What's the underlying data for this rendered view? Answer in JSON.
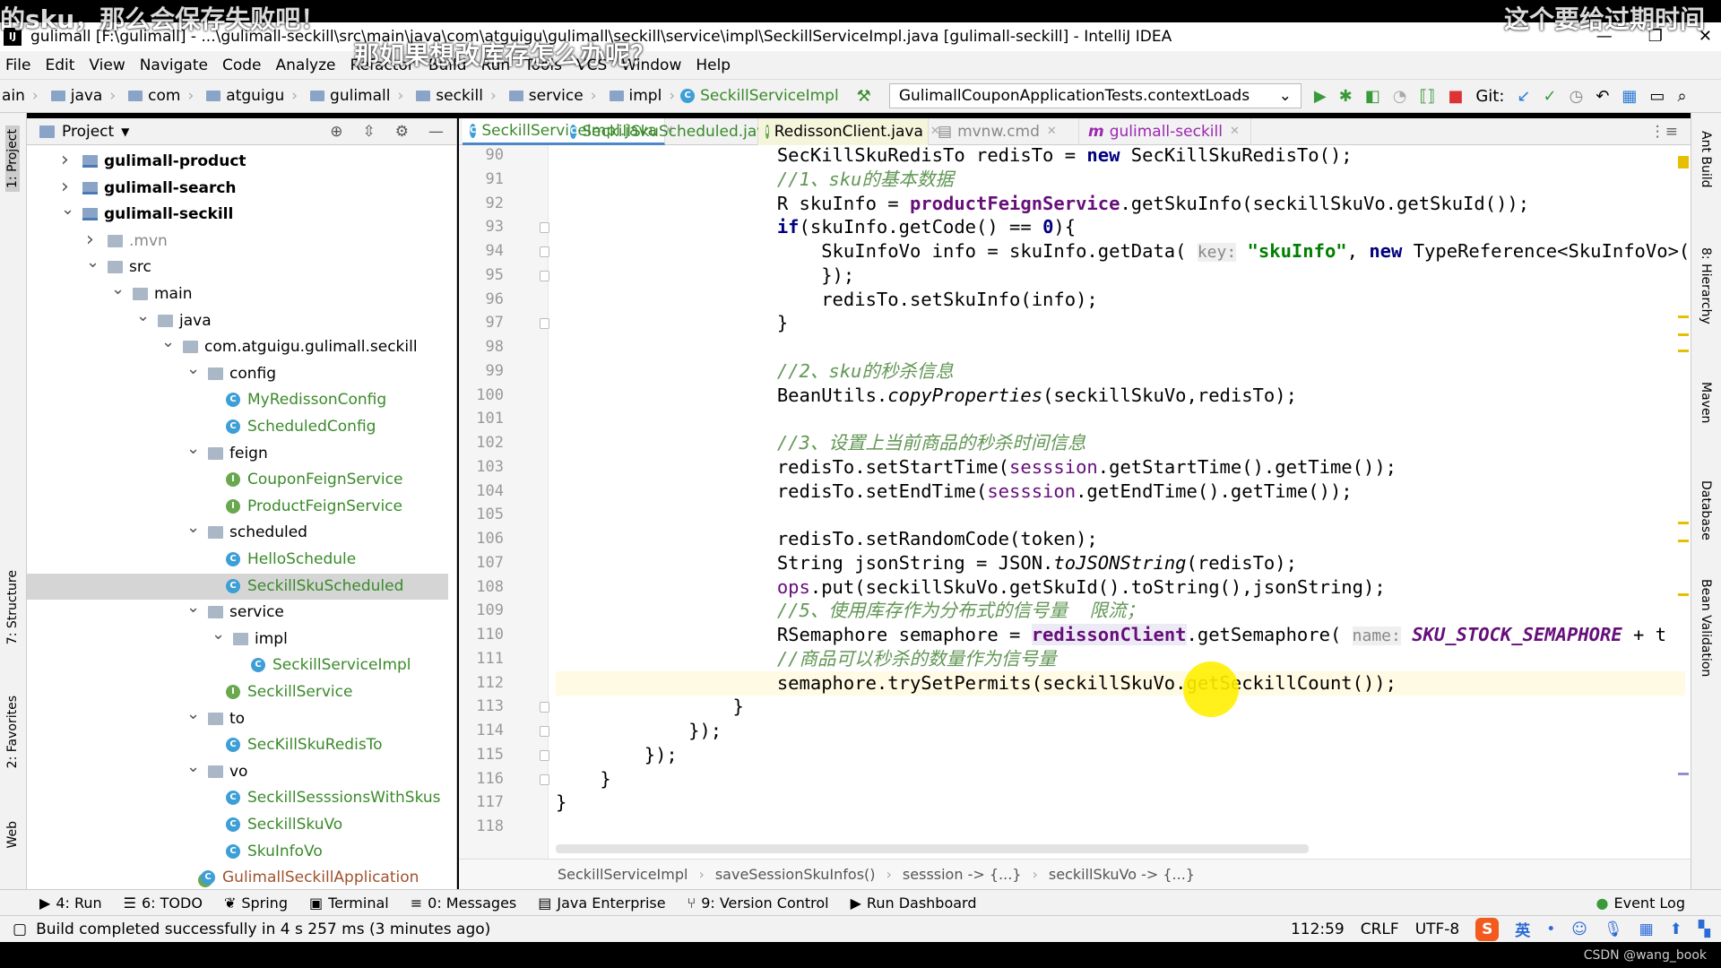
{
  "window": {
    "title": "gulimall [F:\\gulimall] - ...\\gulimall-seckill\\src\\main\\java\\com\\atguigu\\gulimall\\seckill\\service\\impl\\SeckillServiceImpl.java [gulimall-seckill] - IntelliJ IDEA",
    "logo": "IJ"
  },
  "menu": [
    "File",
    "Edit",
    "View",
    "Navigate",
    "Code",
    "Analyze",
    "Refactor",
    "Build",
    "Run",
    "Tools",
    "VCS",
    "Window",
    "Help"
  ],
  "nav": {
    "crumbs": [
      "ain",
      "java",
      "com",
      "atguigu",
      "gulimall",
      "seckill",
      "service",
      "impl"
    ],
    "current": "SeckillServiceImpl",
    "run_config": "GulimallCouponApplicationTests.contextLoads",
    "git_label": "Git:"
  },
  "left_strip": [
    "1: Project",
    "7: Structure",
    "2: Favorites",
    "Web"
  ],
  "right_strip": [
    "Ant Build",
    "8: Hierarchy",
    "Maven",
    "Database",
    "Bean Validation"
  ],
  "project": {
    "title": "Project",
    "tree": [
      {
        "label": "gulimall-product",
        "level": 0,
        "arrow": "right",
        "icon": "module",
        "bold": true
      },
      {
        "label": "gulimall-search",
        "level": 0,
        "arrow": "right",
        "icon": "module",
        "bold": true
      },
      {
        "label": "gulimall-seckill",
        "level": 0,
        "arrow": "down",
        "icon": "module",
        "bold": true
      },
      {
        "label": ".mvn",
        "level": 1,
        "arrow": "right",
        "icon": "folder",
        "color": "#888888"
      },
      {
        "label": "src",
        "level": 1,
        "arrow": "down",
        "icon": "folder"
      },
      {
        "label": "main",
        "level": 2,
        "arrow": "down",
        "icon": "folder"
      },
      {
        "label": "java",
        "level": 3,
        "arrow": "down",
        "icon": "folder"
      },
      {
        "label": "com.atguigu.gulimall.seckill",
        "level": 4,
        "arrow": "down",
        "icon": "folder"
      },
      {
        "label": "config",
        "level": 5,
        "arrow": "down",
        "icon": "folder"
      },
      {
        "label": "MyRedissonConfig",
        "level": 6,
        "icon": "class",
        "color": "#3a8a2a"
      },
      {
        "label": "ScheduledConfig",
        "level": 6,
        "icon": "class",
        "color": "#3a8a2a"
      },
      {
        "label": "feign",
        "level": 5,
        "arrow": "down",
        "icon": "folder"
      },
      {
        "label": "CouponFeignService",
        "level": 6,
        "icon": "interface",
        "color": "#3a8a2a"
      },
      {
        "label": "ProductFeignService",
        "level": 6,
        "icon": "interface",
        "color": "#3a8a2a"
      },
      {
        "label": "scheduled",
        "level": 5,
        "arrow": "down",
        "icon": "folder"
      },
      {
        "label": "HelloSchedule",
        "level": 6,
        "icon": "class",
        "color": "#3a8a2a"
      },
      {
        "label": "SeckillSkuScheduled",
        "level": 6,
        "icon": "class",
        "color": "#3a8a2a",
        "selected": true
      },
      {
        "label": "service",
        "level": 5,
        "arrow": "down",
        "icon": "folder"
      },
      {
        "label": "impl",
        "level": 6,
        "arrow": "down",
        "icon": "folder"
      },
      {
        "label": "SeckillServiceImpl",
        "level": 7,
        "icon": "class",
        "color": "#3a8a2a"
      },
      {
        "label": "SeckillService",
        "level": 6,
        "icon": "interface",
        "color": "#3a8a2a"
      },
      {
        "label": "to",
        "level": 5,
        "arrow": "down",
        "icon": "folder"
      },
      {
        "label": "SecKillSkuRedisTo",
        "level": 6,
        "icon": "class",
        "color": "#3a8a2a"
      },
      {
        "label": "vo",
        "level": 5,
        "arrow": "down",
        "icon": "folder"
      },
      {
        "label": "SeckillSesssionsWithSkus",
        "level": 6,
        "icon": "class",
        "color": "#3a8a2a"
      },
      {
        "label": "SeckillSkuVo",
        "level": 6,
        "icon": "class",
        "color": "#3a8a2a"
      },
      {
        "label": "SkuInfoVo",
        "level": 6,
        "icon": "class",
        "color": "#3a8a2a"
      },
      {
        "label": "GulimallSeckillApplication",
        "level": 5,
        "icon": "boot",
        "color": "#a0522d"
      }
    ]
  },
  "tabs": [
    {
      "label": "SeckillServiceImpl.java",
      "icon": "class",
      "active": true,
      "color": "#3a8a2a"
    },
    {
      "label": "SeckillSkuScheduled.java",
      "icon": "class",
      "color": "#3a8a2a"
    },
    {
      "label": "RedissonClient.java",
      "icon": "interface",
      "color": "#000000"
    },
    {
      "label": "mvnw.cmd",
      "icon": "file",
      "color": "#888888"
    },
    {
      "label": "gulimall-seckill",
      "icon": "maven",
      "color": "#9c27b0"
    }
  ],
  "code": {
    "current_line": 112,
    "lines": [
      {
        "n": 90,
        "t": [
          [
            "                    SecKillSkuRedisTo redisTo = ",
            ""
          ],
          [
            "new",
            "kw"
          ],
          [
            " SecKillSkuRedisTo();",
            ""
          ]
        ]
      },
      {
        "n": 91,
        "t": [
          [
            "                    //1、sku的基本数据",
            "cm"
          ]
        ]
      },
      {
        "n": 92,
        "t": [
          [
            "                    R skuInfo = ",
            ""
          ],
          [
            "productFeignService",
            "fld"
          ],
          [
            ".getSkuInfo(seckillSkuVo.getSkuId());",
            ""
          ]
        ]
      },
      {
        "n": 93,
        "t": [
          [
            "                    ",
            ""
          ],
          [
            "if",
            "kw"
          ],
          [
            "(skuInfo.getCode() == ",
            ""
          ],
          [
            "0",
            "kw"
          ],
          [
            "){",
            ""
          ]
        ],
        "fold": true
      },
      {
        "n": 94,
        "t": [
          [
            "                        SkuInfoVo info = skuInfo.getData( ",
            ""
          ],
          [
            "key:",
            "hint"
          ],
          [
            " ",
            ""
          ],
          [
            "\"skuInfo\"",
            "str"
          ],
          [
            ", ",
            ""
          ],
          [
            "new",
            "kw"
          ],
          [
            " TypeReference<SkuInfoVo>(){",
            ""
          ]
        ],
        "fold": true
      },
      {
        "n": 95,
        "t": [
          [
            "                        });",
            ""
          ]
        ],
        "fold": true
      },
      {
        "n": 96,
        "t": [
          [
            "                        redisTo.setSkuInfo(info);",
            ""
          ]
        ]
      },
      {
        "n": 97,
        "t": [
          [
            "                    }",
            ""
          ]
        ],
        "fold": true
      },
      {
        "n": 98,
        "t": []
      },
      {
        "n": 99,
        "t": [
          [
            "                    //2、sku的秒杀信息",
            "cm"
          ]
        ]
      },
      {
        "n": 100,
        "t": [
          [
            "                    BeanUtils.",
            ""
          ],
          [
            "copyProperties",
            "st"
          ],
          [
            "(seckillSkuVo,redisTo);",
            ""
          ]
        ]
      },
      {
        "n": 101,
        "t": []
      },
      {
        "n": 102,
        "t": [
          [
            "                    //3、设置上当前商品的秒杀时间信息",
            "cm"
          ]
        ]
      },
      {
        "n": 103,
        "t": [
          [
            "                    redisTo.setStartTime(",
            ""
          ],
          [
            "sesssion",
            "lv"
          ],
          [
            ".getStartTime().getTime());",
            ""
          ]
        ]
      },
      {
        "n": 104,
        "t": [
          [
            "                    redisTo.setEndTime(",
            ""
          ],
          [
            "sesssion",
            "lv"
          ],
          [
            ".getEndTime().getTime());",
            ""
          ]
        ]
      },
      {
        "n": 105,
        "t": []
      },
      {
        "n": 106,
        "t": [
          [
            "                    redisTo.setRandomCode(token);",
            ""
          ]
        ]
      },
      {
        "n": 107,
        "t": [
          [
            "                    String jsonString = JSON.",
            ""
          ],
          [
            "toJSONString",
            "st"
          ],
          [
            "(redisTo);",
            ""
          ]
        ]
      },
      {
        "n": 108,
        "t": [
          [
            "                    ",
            ""
          ],
          [
            "ops",
            "lv"
          ],
          [
            ".put(seckillSkuVo.getSkuId().toString(),jsonString);",
            ""
          ]
        ]
      },
      {
        "n": 109,
        "t": [
          [
            "                    //5、使用库存作为分布式的信号量  限流；",
            "cm"
          ]
        ]
      },
      {
        "n": 110,
        "t": [
          [
            "                    RSemaphore semaphore = ",
            ""
          ],
          [
            "redissonClient",
            "fldh"
          ],
          [
            ".getSemaphore( ",
            ""
          ],
          [
            "name:",
            "hint"
          ],
          [
            " ",
            ""
          ],
          [
            "SKU_STOCK_SEMAPHORE",
            "cst"
          ],
          [
            " + t",
            ""
          ]
        ]
      },
      {
        "n": 111,
        "t": [
          [
            "                    //商品可以秒杀的数量作为信号量",
            "cm"
          ]
        ]
      },
      {
        "n": 112,
        "t": [
          [
            "                    semaphore.trySetPermits(seckillSkuVo.getSeckillCount());",
            ""
          ]
        ]
      },
      {
        "n": 113,
        "t": [
          [
            "                }",
            ""
          ]
        ],
        "fold": true
      },
      {
        "n": 114,
        "t": [
          [
            "            });",
            ""
          ]
        ],
        "fold": true
      },
      {
        "n": 115,
        "t": [
          [
            "        });",
            ""
          ]
        ],
        "fold": true
      },
      {
        "n": 116,
        "t": [
          [
            "    }",
            ""
          ]
        ],
        "fold": true
      },
      {
        "n": 117,
        "t": [
          [
            "}",
            ""
          ]
        ]
      },
      {
        "n": 118,
        "t": []
      }
    ]
  },
  "editor_breadcrumbs": [
    "SeckillServiceImpl",
    "saveSessionSkuInfos()",
    "sesssion -> {...}",
    "seckillSkuVo -> {...}"
  ],
  "toolwindows": [
    {
      "icon": "run-icon",
      "label": "4: Run",
      "glyph": "▶"
    },
    {
      "icon": "todo-icon",
      "label": "6: TODO",
      "glyph": "☰"
    },
    {
      "icon": "spring-icon",
      "label": "Spring",
      "glyph": "❦"
    },
    {
      "icon": "terminal-icon",
      "label": "Terminal",
      "glyph": "▣"
    },
    {
      "icon": "messages-icon",
      "label": "0: Messages",
      "glyph": "≡"
    },
    {
      "icon": "java-enterprise-icon",
      "label": "Java Enterprise",
      "glyph": "▤"
    },
    {
      "icon": "version-control-icon",
      "label": "9: Version Control",
      "glyph": "⑂"
    },
    {
      "icon": "run-dashboard-icon",
      "label": "Run Dashboard",
      "glyph": "▶"
    }
  ],
  "event_log": "Event Log",
  "status": {
    "message": "Build completed successfully in 4 s 257 ms (3 minutes ago)",
    "position": "112:59",
    "line_sep": "CRLF",
    "encoding": "UTF-8",
    "ime_logo": "S",
    "ime_lang": "英"
  },
  "subtitles": [
    "的sku，那么会保存失败吧！",
    "那如果想改库存怎么办呢？",
    "这个要给过期时间"
  ],
  "watermark": "CSDN @wang_book",
  "colors": {
    "accent": "#3d9fd6",
    "comment": "#629755",
    "keyword": "#000080",
    "field": "#660e7a",
    "current_line": "#fffae3"
  }
}
